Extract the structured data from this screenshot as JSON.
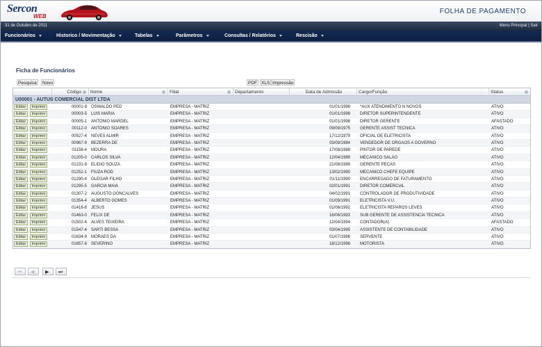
{
  "header": {
    "brand": "Sercon",
    "brand_sub": "WEB",
    "page_title": "FOLHA DE PAGAMENTO"
  },
  "infobar": {
    "date": "31 de Outubro de 2011",
    "menu_principal": "Menu Principal",
    "separator": "|",
    "sair": "Sair"
  },
  "menu": [
    {
      "label": "Funcionários"
    },
    {
      "label": "Historico / Movimentação"
    },
    {
      "label": "Tabelas"
    },
    {
      "label": "Parâmetros"
    },
    {
      "label": "Consultas / Relatórios"
    },
    {
      "label": "Rescisão"
    }
  ],
  "section_title": "Ficha de Funcionários",
  "toolbar": {
    "pesquisa": "Pesquisa",
    "novo": "Novo",
    "pdf": "PDF",
    "xls": "XLS",
    "impressao": "Impressão"
  },
  "grid": {
    "columns": [
      "Código",
      "Nome",
      "Filial",
      "Departamento",
      "Data de Admissão",
      "Cargo/Função",
      "Status"
    ],
    "group": "U00001 - AUTUS COMERCIAL DIST LTDA",
    "edit_label": "Editar",
    "print_label": "Imprimir",
    "rows": [
      [
        "00001-9",
        "OSWALDO PED",
        "EMPRESA - MATRIZ",
        "",
        "01/01/1998",
        "*AUX ATENDIMENTO N NOVOS",
        "ATIVO"
      ],
      [
        "00003-5",
        "LUIS MARIA",
        "EMPRESA - MATRIZ",
        "",
        "01/01/1998",
        "DIRETOR SUPERINTENDENTE",
        "ATIVO"
      ],
      [
        "00005-1",
        "ANTONIO MARDEL",
        "EMPRESA - MATRIZ",
        "",
        "01/01/1998",
        "DIRETOR GERENTE",
        "AFASTADO"
      ],
      [
        "00112-0",
        "ANTONIO SOARES",
        "EMPRESA - MATRIZ",
        "",
        "09/09/1975",
        "GERENTE ASSIST TECNICA",
        "ATIVO"
      ],
      [
        "00527-4",
        "NEVES ALMIR",
        "EMPRESA - MATRIZ",
        "",
        "17/12/1979",
        "OFICIAL DE ELETRICISTA",
        "ATIVO"
      ],
      [
        "00967-9",
        "BEZERRA DE",
        "EMPRESA - MATRIZ",
        "",
        "03/09/1984",
        "VENDEDOR DE ORGAOS A GOVERNO",
        "ATIVO"
      ],
      [
        "01158-4",
        "MOURA",
        "EMPRESA - MATRIZ",
        "",
        "17/08/1988",
        "PINTOR DE PAREDE",
        "ATIVO"
      ],
      [
        "01205-0",
        "CARLOS SILVA",
        "EMPRESA - MATRIZ",
        "",
        "12/04/1989",
        "MECANICO SALAO",
        "ATIVO"
      ],
      [
        "01231-9",
        "ELIDIO SOUZA",
        "EMPRESA - MATRIZ",
        "",
        "21/08/1989",
        "GERENTE PECAS",
        "ATIVO"
      ],
      [
        "01252-1",
        "FIUZA ROD",
        "EMPRESA - MATRIZ",
        "",
        "13/02/1990",
        "MECANICO CHEFE EQUIPE",
        "ATIVO"
      ],
      [
        "01290-4",
        "OLEGAR FILHO",
        "EMPRESA - MATRIZ",
        "",
        "01/11/1990",
        "ENCARREGADO DE FATURAMENTO",
        "ATIVO"
      ],
      [
        "01295-5",
        "GARCIA MAIA",
        "EMPRESA - MATRIZ",
        "",
        "02/01/1991",
        "DIRETOR COMERCIAL",
        "ATIVO"
      ],
      [
        "01307-2",
        "AUGUSTO GONCALVES",
        "EMPRESA - MATRIZ",
        "",
        "04/02/1991",
        "CONTROLADOR DE PRODUTIVIDADE",
        "ATIVO"
      ],
      [
        "01354-4",
        "ALBERTO GOMES",
        "EMPRESA - MATRIZ",
        "",
        "01/09/1991",
        "ELETRICISTA V.U.",
        "ATIVO"
      ],
      [
        "01416-8",
        "JESUS",
        "EMPRESA - MATRIZ",
        "",
        "01/06/1992",
        "ELETRICISTA REPAROS LEVES",
        "ATIVO"
      ],
      [
        "01463-0",
        "FELIX DE",
        "EMPRESA - MATRIZ",
        "",
        "16/06/1993",
        "SUB GERENTE DE ASSISTENCIA TECNICA",
        "ATIVO"
      ],
      [
        "01502-4",
        "ALVES TEIXEIRA",
        "EMPRESA - MATRIZ",
        "",
        "12/04/1994",
        "CONTADOR(A)",
        "AFASTADO"
      ],
      [
        "01547-4",
        "SARTI BESSA",
        "EMPRESA - MATRIZ",
        "",
        "03/04/1995",
        "ASSISTENTE DE CONTABILIDADE",
        "ATIVO"
      ],
      [
        "01634-9",
        "MORAES DA",
        "EMPRESA - MATRIZ",
        "",
        "01/07/1996",
        "SERVENTE",
        "ATIVO"
      ],
      [
        "01657-8",
        "SEVERINO",
        "EMPRESA - MATRIZ",
        "",
        "18/12/1996",
        "MOTORISTA",
        "ATIVO"
      ]
    ]
  },
  "pager": {
    "first_icon": "first-page-icon",
    "prev_icon": "prev-page-icon",
    "next_icon": "next-page-icon",
    "last_icon": "last-page-icon"
  },
  "colors": {
    "menubar": "#142a52",
    "group_row": "#cfd7e2",
    "title_blue": "#1f3e6e",
    "brand_red": "#c8161d"
  }
}
